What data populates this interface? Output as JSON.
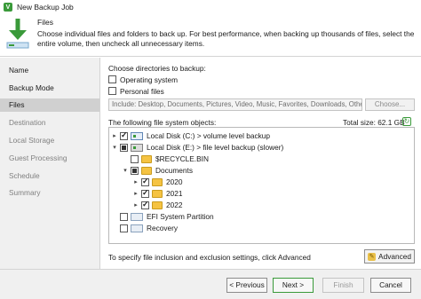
{
  "window": {
    "title": "New Backup Job"
  },
  "header": {
    "title": "Files",
    "description": "Choose individual files and folders to back up. For best performance, when backing up thousands of files, select the entire volume, then uncheck all unnecessary items."
  },
  "sidebar": {
    "items": [
      {
        "label": "Name",
        "state": "normal"
      },
      {
        "label": "Backup Mode",
        "state": "normal"
      },
      {
        "label": "Files",
        "state": "active"
      },
      {
        "label": "Destination",
        "state": "disabled"
      },
      {
        "label": "Local Storage",
        "state": "disabled"
      },
      {
        "label": "Guest Processing",
        "state": "disabled"
      },
      {
        "label": "Schedule",
        "state": "disabled"
      },
      {
        "label": "Summary",
        "state": "disabled"
      }
    ]
  },
  "main": {
    "choose_label": "Choose directories to backup:",
    "operating_system_label": "Operating system",
    "personal_files_label": "Personal files",
    "include_value": "Include: Desktop, Documents, Pictures, Video, Music, Favorites, Downloads, Other",
    "choose_button": "Choose...",
    "objects_label": "The following file system objects:",
    "total_size": "Total size:  62.1 GB",
    "tree": [
      {
        "label": "Local Disk (C:) > volume level backup",
        "depth": 0,
        "arrow": "▸",
        "check": "checked",
        "icon": "disk"
      },
      {
        "label": "Local Disk (E:) > file level backup (slower)",
        "depth": 0,
        "arrow": "▾",
        "check": "partial",
        "icon": "disk"
      },
      {
        "label": "$RECYCLE.BIN",
        "depth": 1,
        "arrow": "",
        "check": "unchecked",
        "icon": "folder"
      },
      {
        "label": "Documents",
        "depth": 1,
        "arrow": "▾",
        "check": "partial",
        "icon": "folder"
      },
      {
        "label": "2020",
        "depth": 2,
        "arrow": "▸",
        "check": "checked",
        "icon": "folder"
      },
      {
        "label": "2021",
        "depth": 2,
        "arrow": "▸",
        "check": "checked",
        "icon": "folder"
      },
      {
        "label": "2022",
        "depth": 2,
        "arrow": "▸",
        "check": "checked",
        "icon": "folder"
      },
      {
        "label": "EFI System Partition",
        "depth": 0,
        "arrow": "",
        "check": "unchecked",
        "icon": "partition"
      },
      {
        "label": "Recovery",
        "depth": 0,
        "arrow": "",
        "check": "unchecked",
        "icon": "partition"
      }
    ],
    "advanced_hint": "To specify file inclusion and exclusion settings, click Advanced",
    "advanced_button": "Advanced"
  },
  "footer": {
    "previous": "< Previous",
    "next": "Next >",
    "finish": "Finish",
    "cancel": "Cancel"
  }
}
